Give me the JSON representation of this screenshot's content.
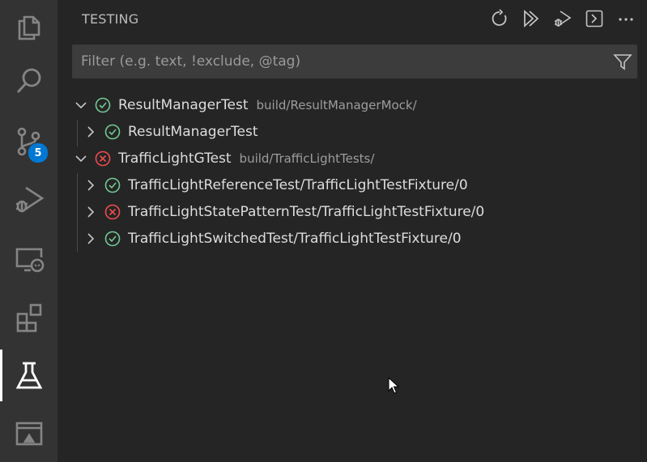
{
  "activity_bar": {
    "items": [
      {
        "name": "explorer",
        "icon": "files-icon"
      },
      {
        "name": "search",
        "icon": "search-icon"
      },
      {
        "name": "source-control",
        "icon": "source-control-icon",
        "badge": "5"
      },
      {
        "name": "run-and-debug",
        "icon": "run-debug-icon"
      },
      {
        "name": "remote-explorer",
        "icon": "remote-explorer-icon"
      },
      {
        "name": "extensions",
        "icon": "extensions-icon"
      },
      {
        "name": "testing",
        "icon": "beaker-icon",
        "active": true
      },
      {
        "name": "panel",
        "icon": "panel-icon"
      }
    ]
  },
  "sidebar": {
    "title": "TESTING",
    "toolbar": [
      "refresh-icon",
      "run-all-icon",
      "debug-all-icon",
      "show-output-icon",
      "more-actions-icon"
    ],
    "filter": {
      "placeholder": "Filter (e.g. text, !exclude, @tag)",
      "value": ""
    }
  },
  "tests": [
    {
      "label": "ResultManagerTest",
      "description": "build/ResultManagerMock/",
      "status": "passed",
      "expanded": true,
      "level": 0
    },
    {
      "label": "ResultManagerTest",
      "description": "",
      "status": "passed",
      "expanded": false,
      "level": 1
    },
    {
      "label": "TrafficLightGTest",
      "description": "build/TrafficLightTests/",
      "status": "failed",
      "expanded": true,
      "level": 0
    },
    {
      "label": "TrafficLightReferenceTest/TrafficLightTestFixture/0",
      "description": "",
      "status": "passed",
      "expanded": false,
      "level": 1
    },
    {
      "label": "TrafficLightStatePatternTest/TrafficLightTestFixture/0",
      "description": "",
      "status": "failed",
      "expanded": false,
      "level": 1
    },
    {
      "label": "TrafficLightSwitchedTest/TrafficLightTestFixture/0",
      "description": "",
      "status": "passed",
      "expanded": false,
      "level": 1
    }
  ],
  "colors": {
    "passed": "#73c991",
    "failed": "#f14c4c",
    "badge": "#0078d4",
    "active_indicator": "#ffffff"
  }
}
